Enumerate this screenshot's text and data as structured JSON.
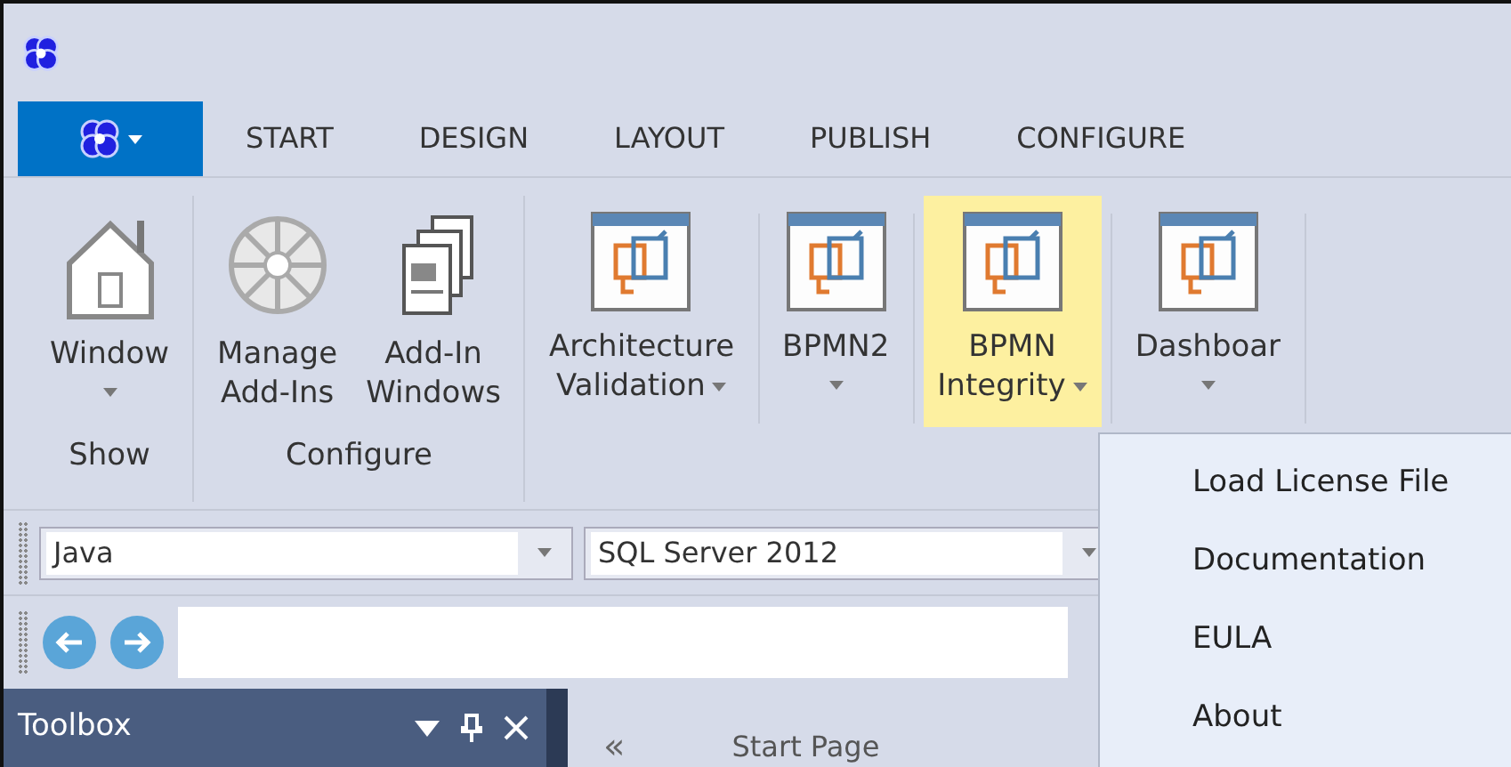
{
  "menu_tabs": [
    {
      "label": "START"
    },
    {
      "label": "DESIGN"
    },
    {
      "label": "LAYOUT"
    },
    {
      "label": "PUBLISH"
    },
    {
      "label": "CONFIGURE"
    }
  ],
  "ribbon": {
    "groups": [
      {
        "label": "Show",
        "buttons": [
          {
            "lines": [
              "Window"
            ],
            "kind": "house",
            "dropdown": true,
            "highlighted": false
          }
        ]
      },
      {
        "label": "Configure",
        "buttons": [
          {
            "lines": [
              "Manage",
              "Add-Ins"
            ],
            "kind": "wheel",
            "dropdown": false,
            "highlighted": false
          },
          {
            "lines": [
              "Add-In",
              "Windows"
            ],
            "kind": "documents",
            "dropdown": false,
            "highlighted": false
          }
        ]
      },
      {
        "buttons": [
          {
            "lines": [
              "Architecture",
              "Validation"
            ],
            "kind": "addin",
            "dropdown": true,
            "highlighted": false
          }
        ]
      },
      {
        "buttons": [
          {
            "lines": [
              "BPMN2"
            ],
            "kind": "addin",
            "dropdown": true,
            "highlighted": false
          }
        ]
      },
      {
        "buttons": [
          {
            "lines": [
              "BPMN",
              "Integrity"
            ],
            "kind": "addin",
            "dropdown": true,
            "highlighted": true
          }
        ]
      },
      {
        "buttons": [
          {
            "lines": [
              "Dashboar"
            ],
            "kind": "addin",
            "dropdown": true,
            "highlighted": false
          }
        ]
      }
    ]
  },
  "toolbar": {
    "combos": [
      {
        "value": "Java"
      },
      {
        "value": "SQL Server 2012"
      }
    ]
  },
  "toolbox": {
    "title": "Toolbox"
  },
  "document_tab": {
    "scroll": "«",
    "label": "Start Page"
  },
  "dropdown_menu": {
    "items": [
      {
        "label": "Load License File"
      },
      {
        "label": "Documentation"
      },
      {
        "label": "EULA"
      },
      {
        "label": "About"
      }
    ]
  }
}
